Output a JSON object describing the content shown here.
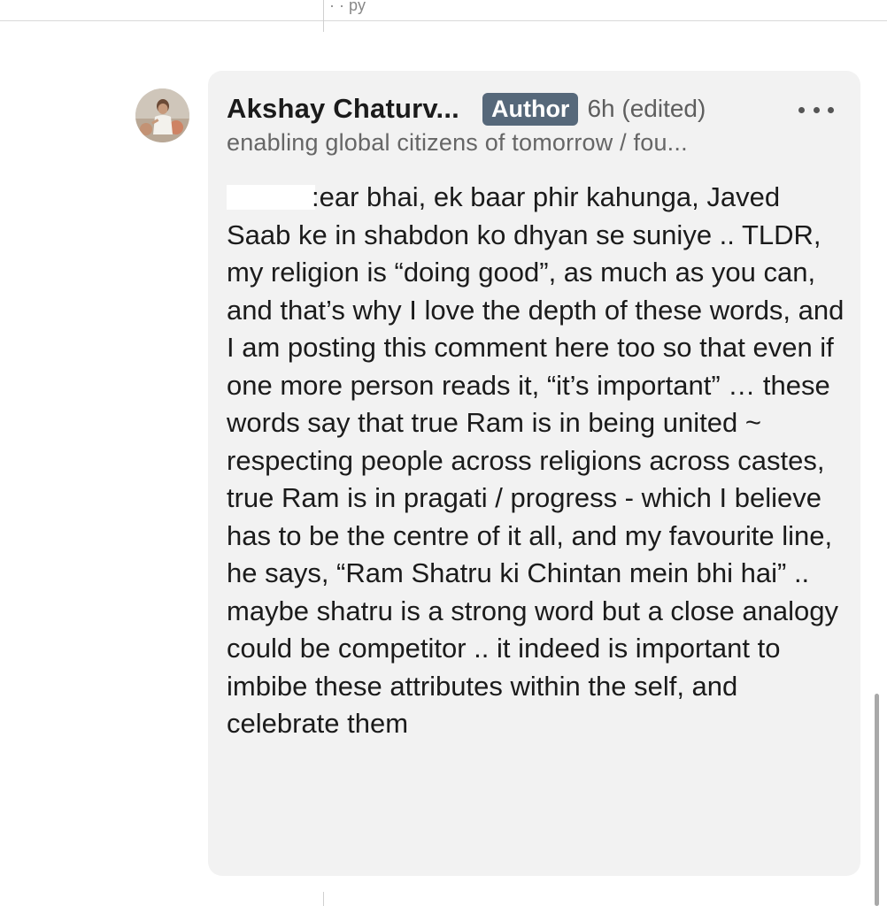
{
  "top_fragment": "· · py",
  "comment": {
    "author_name": "Akshay Chaturv...",
    "badge": "Author",
    "timestamp": "6h (edited)",
    "headline": "enabling global citizens of tomorrow / fou...",
    "body_start": ":ear bhai, ek baar phir kahunga,",
    "body_rest": "Javed Saab ke in shabdon ko dhyan se suniye .. TLDR, my religion is “doing good”, as much as you can, and that’s why I love the depth of these words, and I am posting this comment here too so that even if one more person reads it, “it’s important” … these words say that true Ram is in being united ~ respecting people across religions across castes, true Ram is in pragati / progress - which I believe has to be the centre of it all, and my favourite line, he says, “Ram Shatru ki Chintan mein bhi hai” .. maybe shatru is a strong word but a close analogy could be competitor .. it indeed is important to imbibe these attributes within the self, and celebrate them"
  },
  "icons": {
    "more": "more-horizontal-icon",
    "avatar": "profile-photo"
  },
  "colors": {
    "bubble_bg": "#f2f2f2",
    "badge_bg": "#56687a",
    "badge_text": "#ffffff",
    "secondary_text": "#666666"
  }
}
